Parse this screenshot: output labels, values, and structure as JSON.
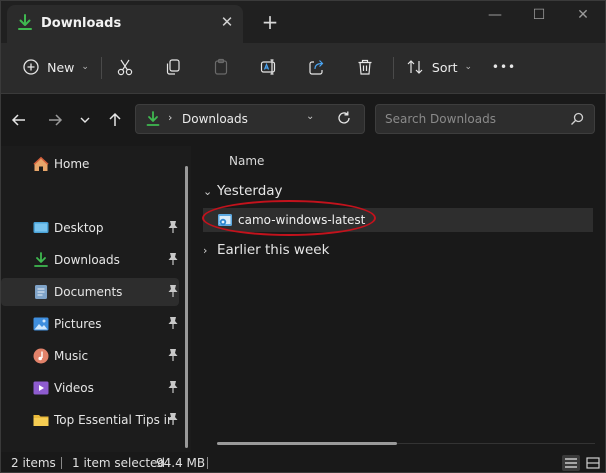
{
  "tab": {
    "title": "Downloads",
    "close_glyph": "✕",
    "new_tab_glyph": "+"
  },
  "window_controls": {
    "minimize": "—",
    "maximize": "☐",
    "close": "✕"
  },
  "toolbar": {
    "new_label": "New",
    "sort_label": "Sort",
    "more_glyph": "•••",
    "caret": "⌄"
  },
  "address_bar": {
    "separator": "›",
    "location": "Downloads",
    "dropdown_glyph": "⌄"
  },
  "search": {
    "placeholder": "Search Downloads"
  },
  "sidebar": {
    "items": [
      {
        "label": "Home",
        "icon": "home-icon",
        "pinned": false
      },
      {
        "label": "Desktop",
        "icon": "desktop-icon",
        "pinned": true
      },
      {
        "label": "Downloads",
        "icon": "download-icon",
        "pinned": true
      },
      {
        "label": "Documents",
        "icon": "documents-icon",
        "pinned": true,
        "selected": true
      },
      {
        "label": "Pictures",
        "icon": "pictures-icon",
        "pinned": true
      },
      {
        "label": "Music",
        "icon": "music-icon",
        "pinned": true
      },
      {
        "label": "Videos",
        "icon": "videos-icon",
        "pinned": true
      },
      {
        "label": "Top Essential Tips in",
        "icon": "folder-icon",
        "pinned": true
      }
    ]
  },
  "content": {
    "column_name": "Name",
    "groups": [
      {
        "label": "Yesterday",
        "expanded": true,
        "files": [
          {
            "name": "camo-windows-latest",
            "selected": true,
            "highlighted": true
          }
        ]
      },
      {
        "label": "Earlier this week",
        "expanded": false,
        "files": []
      }
    ],
    "expanded_glyph": "⌄",
    "collapsed_glyph": "›"
  },
  "status": {
    "item_count": "2 items",
    "selection": "1 item selected",
    "size": "94.4 MB"
  },
  "colors": {
    "accent_download": "#3fb950",
    "highlight_ring": "#c3121c",
    "background": "#191919",
    "toolbar": "#2b2b2b"
  }
}
